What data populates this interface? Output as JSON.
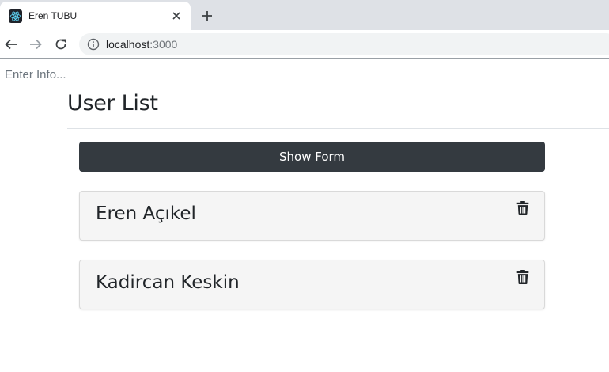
{
  "browser": {
    "tab_title": "Eren TUBU",
    "url_host": "localhost",
    "url_port": ":3000"
  },
  "page": {
    "input_placeholder": "Enter Info...",
    "title": "User List",
    "show_form_label": "Show Form",
    "users": [
      {
        "name": "Eren Açıkel"
      },
      {
        "name": "Kadircan Keskin"
      }
    ]
  },
  "icons": {
    "favicon": "react-logo-icon",
    "tab_close": "close-icon",
    "new_tab": "plus-icon",
    "back": "arrow-left-icon",
    "forward": "arrow-right-icon",
    "reload": "reload-icon",
    "site_info": "info-icon",
    "delete": "trash-icon"
  },
  "colors": {
    "button_dark": "#343a40",
    "card_bg": "#f5f5f5",
    "tabstrip_bg": "#dee1e6",
    "react_cyan": "#61dafb"
  }
}
